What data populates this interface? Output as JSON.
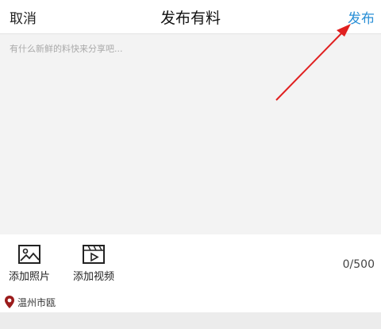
{
  "header": {
    "cancel_label": "取消",
    "title": "发布有料",
    "publish_label": "发布"
  },
  "editor": {
    "placeholder": "有什么新鲜的料快来分享吧...",
    "value": ""
  },
  "toolbar": {
    "add_photo_label": "添加照片",
    "add_video_label": "添加视频",
    "char_counter": "0/500"
  },
  "location": {
    "text": "温州市瓯"
  },
  "icons": {
    "photo": "photo-icon",
    "video": "video-icon",
    "location": "location-pin-icon"
  },
  "colors": {
    "accent": "#2a8fd6",
    "annotation_arrow": "#e02020",
    "location_pin": "#9b1c1c",
    "editor_bg": "#f3f3f3"
  }
}
